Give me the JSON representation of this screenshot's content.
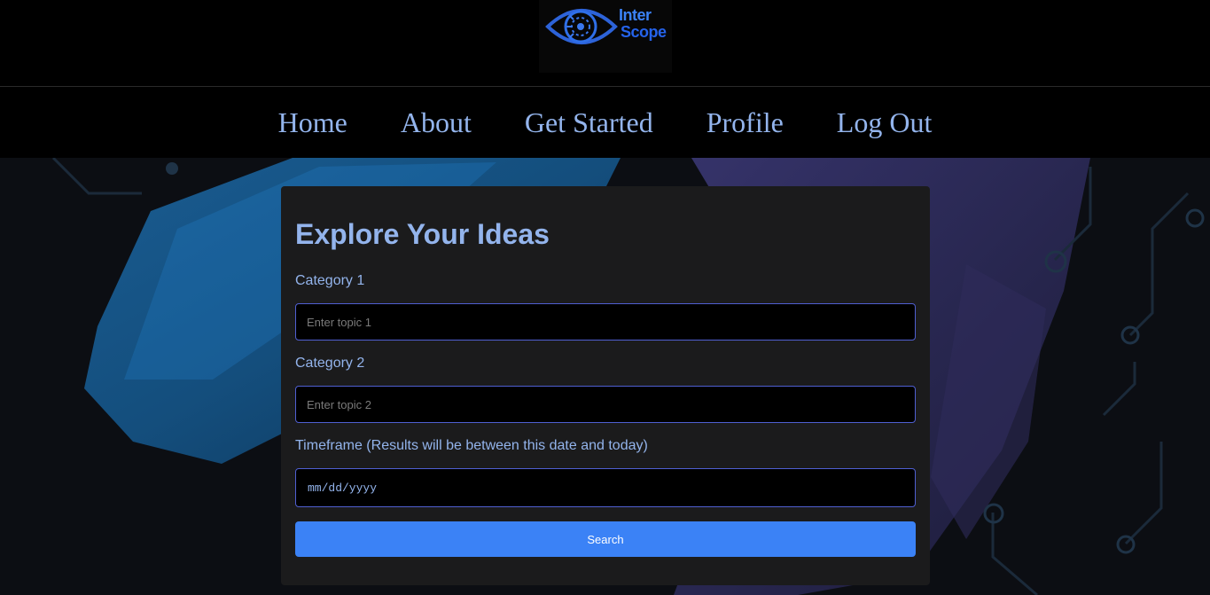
{
  "brand": {
    "logo_line1": "Inter",
    "logo_line2": "Scope",
    "logo_icon": "eye-logo-icon",
    "accent_color": "#2f6fe8"
  },
  "nav": {
    "items": [
      {
        "label": "Home"
      },
      {
        "label": "About"
      },
      {
        "label": "Get Started"
      },
      {
        "label": "Profile"
      },
      {
        "label": "Log Out"
      }
    ]
  },
  "form": {
    "title": "Explore Your Ideas",
    "category1_label": "Category 1",
    "category1_placeholder": "Enter topic 1",
    "category1_value": "",
    "category2_label": "Category 2",
    "category2_placeholder": "Enter topic 2",
    "category2_value": "",
    "timeframe_label": "Timeframe (Results will be between this date and today)",
    "timeframe_placeholder": "mm/dd/yyyy",
    "search_label": "Search"
  },
  "colors": {
    "text_accent": "#93b4ec",
    "button": "#3b82f6",
    "card_bg": "#1b1b1c",
    "input_border": "#4f5fd1"
  }
}
